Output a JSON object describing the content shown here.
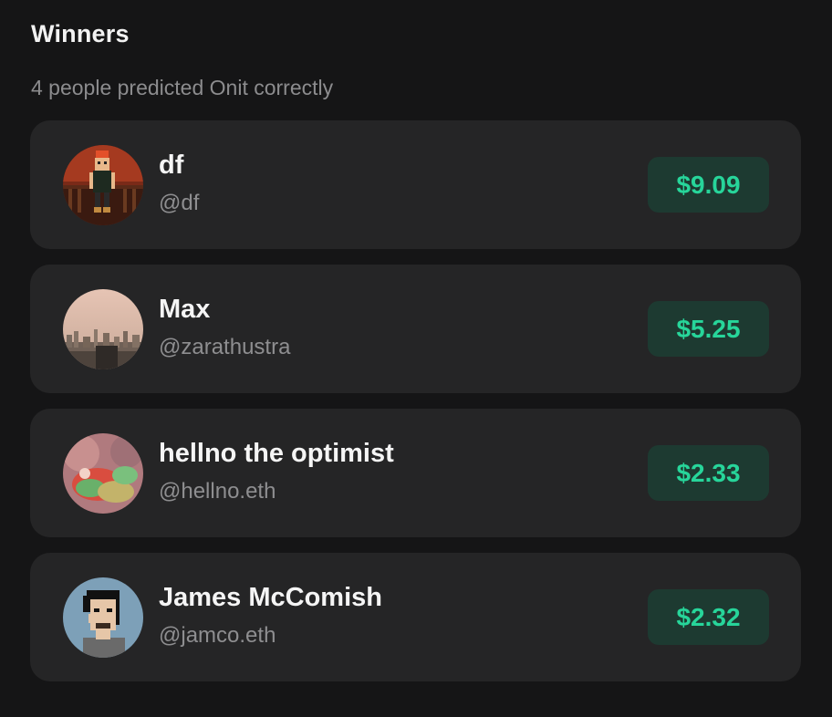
{
  "header": {
    "title": "Winners",
    "subtitle": "4 people predicted Onit correctly"
  },
  "winners": [
    {
      "name": "df",
      "handle": "@df",
      "amount": "$9.09",
      "avatar_icon": "pixel-character-avatar-icon"
    },
    {
      "name": "Max",
      "handle": "@zarathustra",
      "amount": "$5.25",
      "avatar_icon": "city-skyline-avatar-icon"
    },
    {
      "name": "hellno the optimist",
      "handle": "@hellno.eth",
      "amount": "$2.33",
      "avatar_icon": "abstract-avatar-icon"
    },
    {
      "name": "James McComish",
      "handle": "@jamco.eth",
      "amount": "$2.32",
      "avatar_icon": "pixel-portrait-avatar-icon"
    }
  ],
  "colors": {
    "background": "#151516",
    "card": "#252526",
    "amount_text": "#27d59a",
    "amount_bg": "#1d3a31"
  }
}
